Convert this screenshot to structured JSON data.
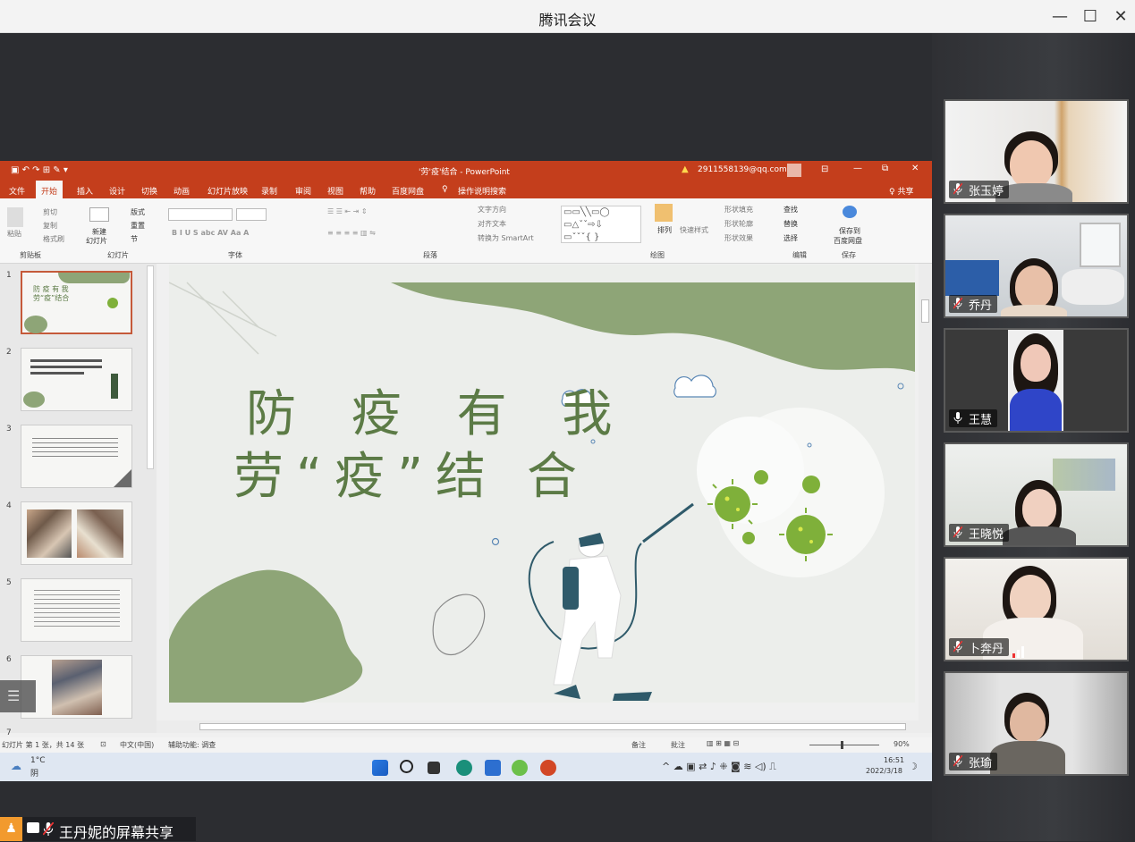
{
  "window": {
    "title": "腾讯会议",
    "minimize": "—",
    "maximize": "☐",
    "close": "✕"
  },
  "ppt": {
    "title": "'劳'疫'结合  -  PowerPoint",
    "warning": "▲",
    "account": "2911558139@qq.com",
    "share": "♀ 共享",
    "tabs": [
      "文件",
      "开始",
      "插入",
      "设计",
      "切换",
      "动画",
      "幻灯片放映",
      "录制",
      "审阅",
      "视图",
      "帮助",
      "百度网盘",
      "操作说明搜索"
    ],
    "ribbon": {
      "clipboard": {
        "paste": "粘贴",
        "cut": "剪切",
        "copy": "复制",
        "format": "格式刷",
        "group": "剪贴板"
      },
      "slides": {
        "new": "新建",
        "new2": "幻灯片",
        "layout": "版式",
        "reset": "重置",
        "section": "节",
        "group": "幻灯片"
      },
      "font": {
        "group": "字体"
      },
      "paragraph": {
        "direction": "文字方向",
        "align": "对齐文本",
        "smartart": "转换为 SmartArt",
        "group": "段落"
      },
      "drawing": {
        "arrange": "排列",
        "quick": "快速样式",
        "fill": "形状填充",
        "outline": "形状轮廓",
        "effect": "形状效果",
        "group": "绘图"
      },
      "editing": {
        "find": "查找",
        "replace": "替换",
        "select": "选择",
        "group": "编辑"
      },
      "save": {
        "line1": "保存到",
        "line2": "百度网盘",
        "group": "保存"
      }
    },
    "slide": {
      "line1": "防 疫 有 我",
      "line2": "劳“疫”结 合"
    },
    "thumbs": [
      "1",
      "2",
      "3",
      "4",
      "5",
      "6",
      "7"
    ],
    "status": {
      "slide": "幻灯片 第 1 张，共 14 张",
      "lang": "中文(中国)",
      "access": "辅助功能: 调查",
      "notes": "备注",
      "comments": "批注",
      "zoom": "90%"
    },
    "taskbar": {
      "temp": "1°C",
      "weather": "阴",
      "time": "16:51",
      "date": "2022/3/18"
    }
  },
  "participants": [
    {
      "name": "张玉婷"
    },
    {
      "name": "乔丹"
    },
    {
      "name": "王慧"
    },
    {
      "name": "王晓悦"
    },
    {
      "name": "卜奔丹"
    },
    {
      "name": "张瑜"
    }
  ],
  "sharing": {
    "label": "王丹妮的屏幕共享"
  },
  "colors": {
    "accent": "#c43e1c",
    "slide_green": "#8ea577",
    "title_green": "#5c7b46"
  }
}
